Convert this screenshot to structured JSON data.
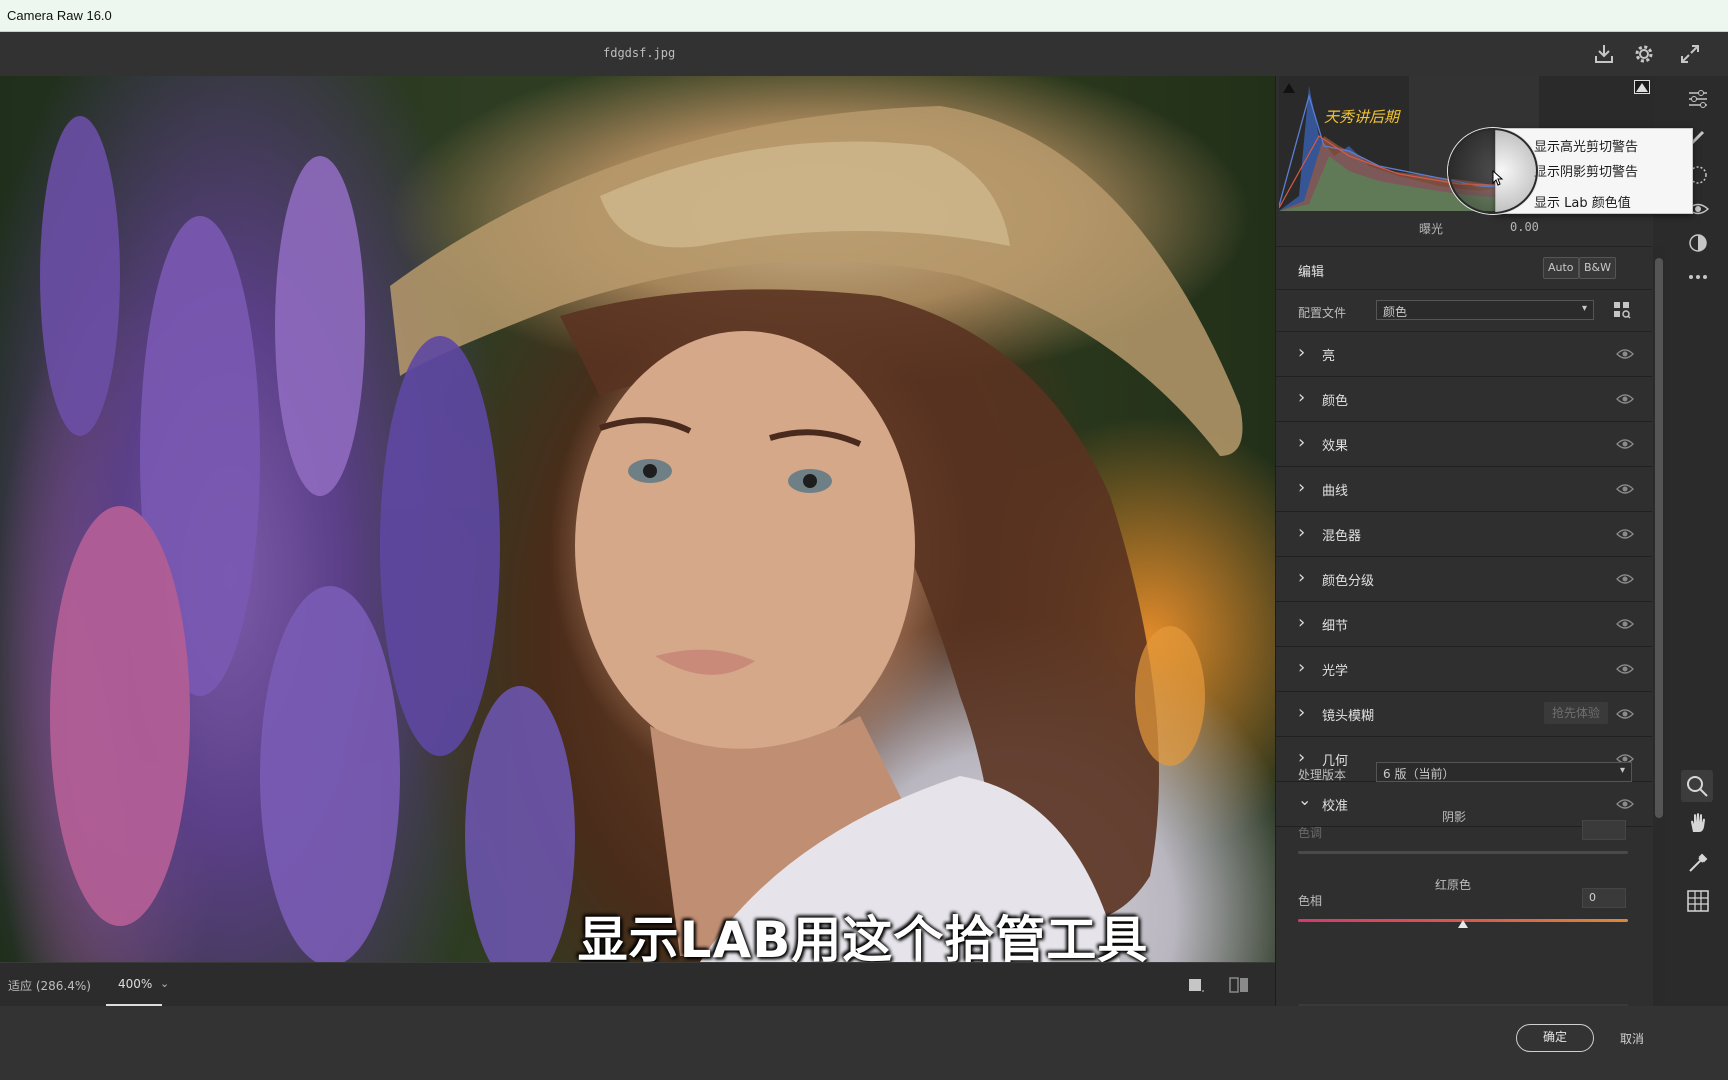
{
  "window": {
    "title": "Camera Raw 16.0"
  },
  "topbar": {
    "filename": "fdgdsf.jpg"
  },
  "histogram": {
    "watermark": "天秀讲后期",
    "exposure_label": "曝光",
    "exposure_value": "0.00"
  },
  "context_menu": {
    "items": [
      "显示高光剪切警告",
      "显示阴影剪切警告",
      "显示 Lab 颜色值"
    ]
  },
  "edit": {
    "title": "编辑",
    "auto_label": "Auto",
    "bw_label": "B&W",
    "profile_label": "配置文件",
    "profile_value": "颜色"
  },
  "sections": [
    {
      "label": "亮"
    },
    {
      "label": "颜色"
    },
    {
      "label": "效果"
    },
    {
      "label": "曲线"
    },
    {
      "label": "混色器"
    },
    {
      "label": "颜色分级"
    },
    {
      "label": "细节"
    },
    {
      "label": "光学"
    },
    {
      "label": "镜头模糊",
      "badge": "抢先体验"
    },
    {
      "label": "几何"
    },
    {
      "label": "校准"
    }
  ],
  "calibration": {
    "process_label": "处理版本",
    "process_value": "6 版（当前）",
    "shadows_heading": "阴影",
    "tint_label": "色调",
    "red_primary_heading": "红原色",
    "hue_label": "色相",
    "hue_value": "0",
    "red_primary_hue_level": 0.5
  },
  "caption": "显示LAB用这个拾管工具",
  "status": {
    "fit_label": "适应 (286.4%)",
    "zoom_value": "400%"
  },
  "footer": {
    "ok_label": "确定",
    "cancel_label": "取消"
  },
  "colors": {
    "panel_bg": "#2f2f2f",
    "titlebar_bg": "#eef7ef",
    "accent_text": "#e0e0e0"
  }
}
